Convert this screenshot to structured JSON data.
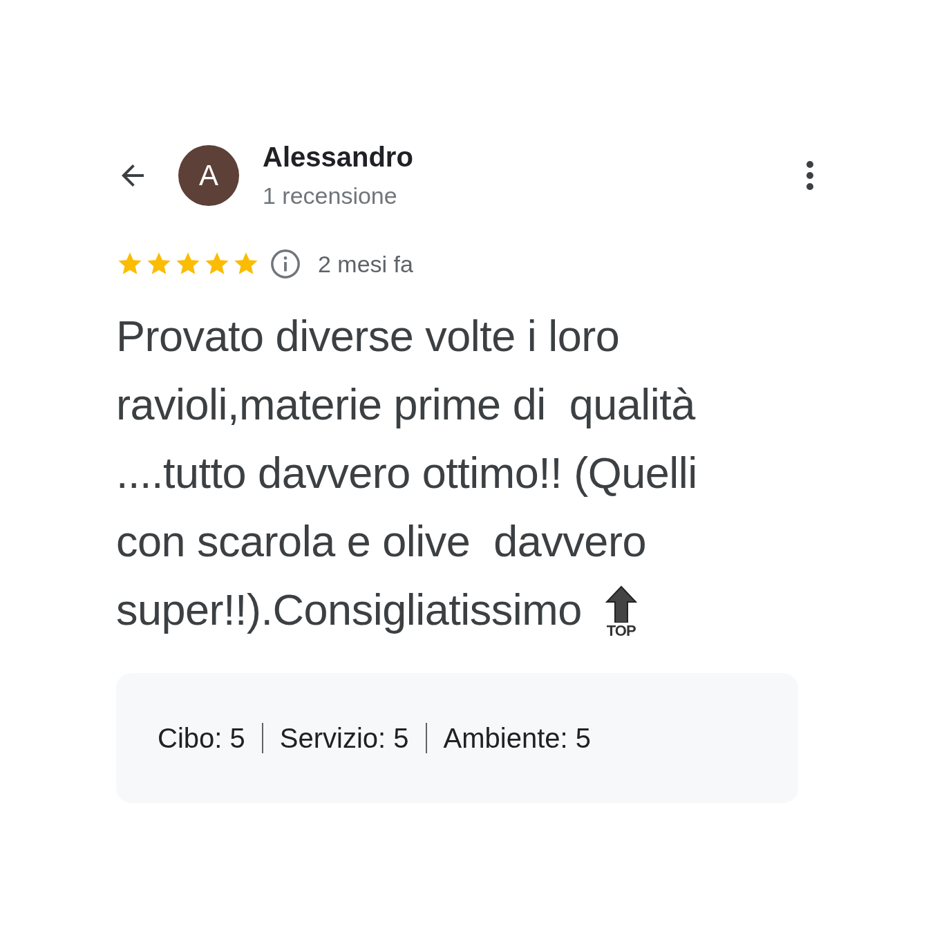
{
  "header": {
    "avatar_letter": "A",
    "name": "Alessandro",
    "subtitle": "1 recensione"
  },
  "review": {
    "stars": 5,
    "time": "2 mesi fa",
    "lines": [
      "Provato diverse volte i loro",
      "ravioli,materie prime di  qualità",
      "....tutto davvero ottimo!! (Quelli",
      "con scarola e olive  davvero",
      "super!!).Consigliatissimo"
    ],
    "emoji_label": "TOP"
  },
  "ratings": [
    {
      "label": "Cibo:",
      "value": "5"
    },
    {
      "label": "Servizio:",
      "value": "5"
    },
    {
      "label": "Ambiente:",
      "value": "5"
    }
  ]
}
